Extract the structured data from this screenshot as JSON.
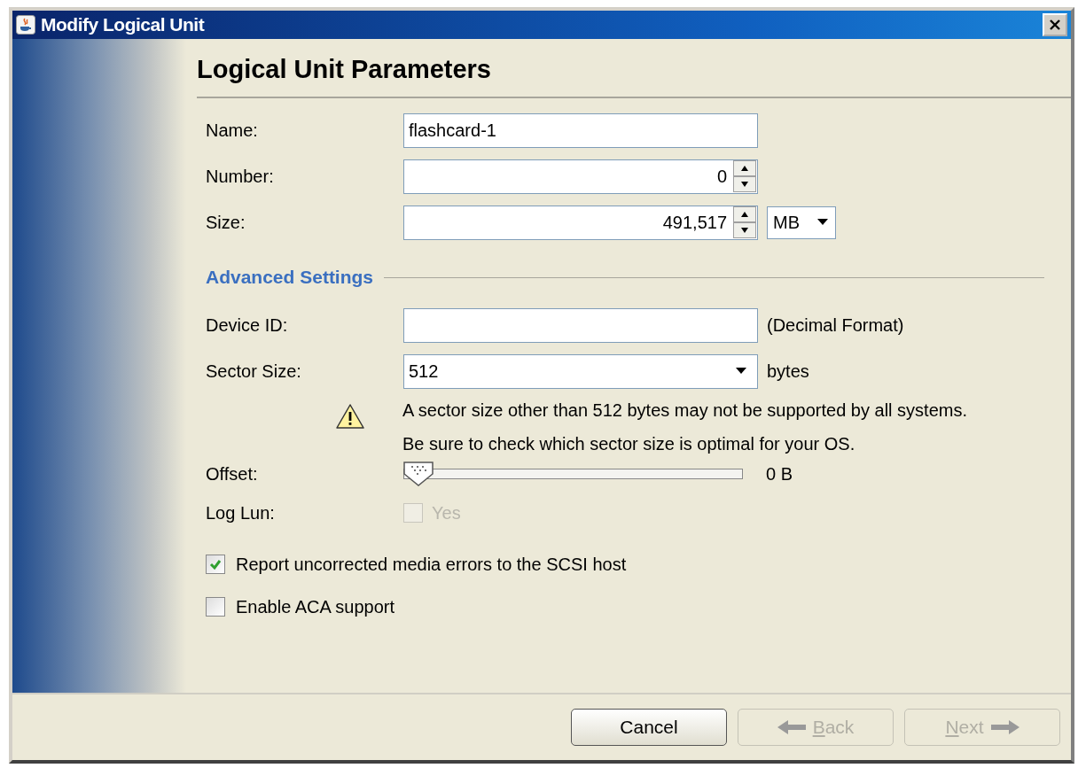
{
  "window": {
    "title": "Modify Logical Unit"
  },
  "heading": "Logical Unit Parameters",
  "fields": [
    {
      "kind": "text",
      "label": "Name:",
      "value": "flashcard-1"
    },
    {
      "kind": "spinner",
      "label": "Number:",
      "value": "0"
    },
    {
      "kind": "spinner",
      "label": "Size:",
      "value": "491,517",
      "unit": "MB"
    }
  ],
  "advanced": {
    "title": "Advanced Settings",
    "fields": [
      {
        "kind": "text",
        "label": "Device ID:",
        "suffix": "(Decimal Format)"
      },
      {
        "kind": "dropdown",
        "label": "Sector Size:",
        "value": "512",
        "suffix": "bytes"
      }
    ],
    "warning": [
      "A sector size other than 512 bytes may not be supported by all systems.",
      "Be sure to check which sector size is optimal for your OS."
    ],
    "offset": {
      "label": "Offset:",
      "level": 0,
      "reading": "0 B"
    },
    "log_lun": {
      "label": "Log Lun:",
      "option": "Yes",
      "checked": false,
      "disabled": true
    }
  },
  "options": [
    {
      "label": "Report uncorrected media errors to the SCSI host",
      "checked": true
    },
    {
      "label": "Enable ACA support",
      "checked": false
    }
  ],
  "buttons": [
    {
      "label": "Cancel",
      "disabled": false,
      "kind": "plain"
    },
    {
      "label": "Back",
      "disabled": true,
      "kind": "back"
    },
    {
      "label": "Next",
      "disabled": true,
      "kind": "next"
    }
  ]
}
